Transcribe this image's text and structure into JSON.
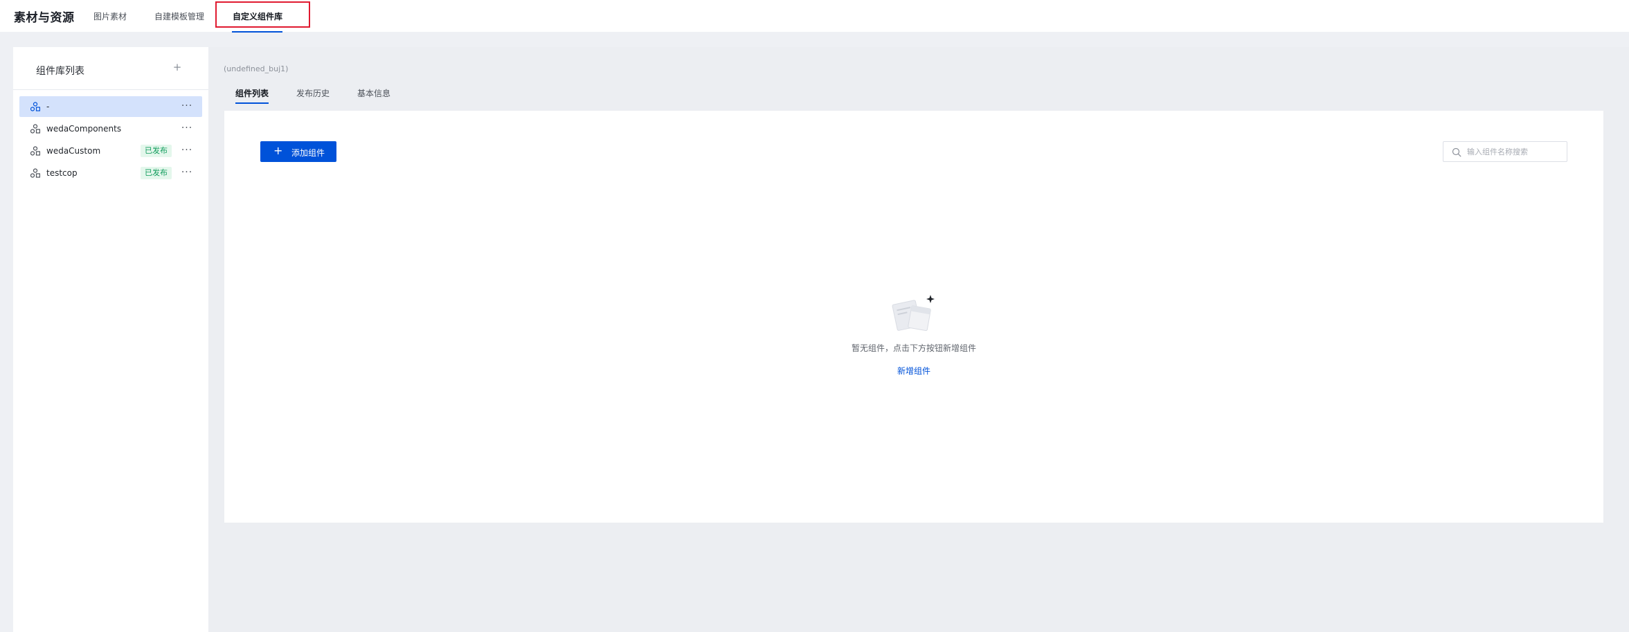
{
  "header": {
    "app_title": "素材与资源",
    "tabs": [
      {
        "label": "图片素材"
      },
      {
        "label": "自建模板管理"
      },
      {
        "label": "自定义组件库"
      }
    ]
  },
  "sidebar": {
    "title": "组件库列表",
    "add_label": "+",
    "more_label": "···",
    "items": [
      {
        "name": "-",
        "badge": ""
      },
      {
        "name": "wedaComponents",
        "badge": ""
      },
      {
        "name": "wedaCustom",
        "badge": "已发布"
      },
      {
        "name": "testcop",
        "badge": "已发布"
      }
    ]
  },
  "main": {
    "library_id": "(undefined_buj1)",
    "tabs": [
      {
        "label": "组件列表"
      },
      {
        "label": "发布历史"
      },
      {
        "label": "基本信息"
      }
    ],
    "add_button": {
      "icon": "+",
      "label": "添加组件"
    },
    "search": {
      "placeholder": "输入组件名称搜索",
      "value": ""
    },
    "empty": {
      "message": "暂无组件，点击下方按钮新增组件",
      "link": "新增组件"
    }
  },
  "colors": {
    "accent": "#0052d9",
    "selected_bg": "#d4e2fc",
    "badge_text": "#119c5c",
    "badge_bg": "#e4f7ec",
    "highlight": "#e0192f"
  }
}
